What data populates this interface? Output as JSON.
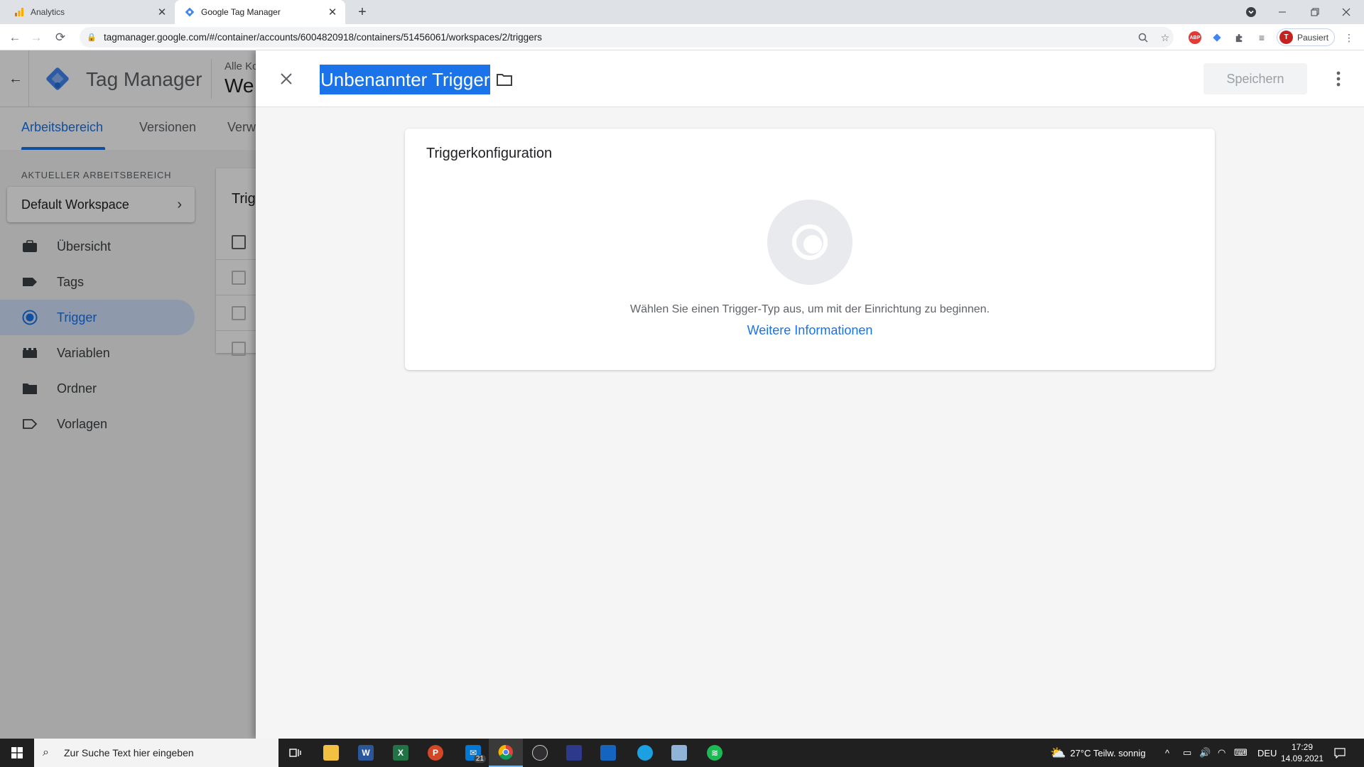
{
  "browser": {
    "tabs": [
      {
        "title": "Analytics",
        "icon": "analytics-icon",
        "active": false
      },
      {
        "title": "Google Tag Manager",
        "icon": "gtm-icon",
        "active": true
      }
    ],
    "url": "tagmanager.google.com/#/container/accounts/6004820918/containers/51456061/workspaces/2/triggers",
    "profile_initial": "T",
    "profile_status": "Pausiert"
  },
  "gtm": {
    "app_title": "Tag Manager",
    "breadcrumb": "Alle Ko",
    "container_name": "We",
    "tabs": [
      {
        "label": "Arbeitsbereich",
        "active": true
      },
      {
        "label": "Versionen",
        "active": false
      },
      {
        "label": "Verw",
        "active": false
      }
    ],
    "workspace_label": "AKTUELLER ARBEITSBEREICH",
    "workspace_name": "Default Workspace",
    "nav": [
      {
        "label": "Übersicht",
        "icon": "briefcase-icon",
        "active": false
      },
      {
        "label": "Tags",
        "icon": "tag-icon",
        "active": false
      },
      {
        "label": "Trigger",
        "icon": "trigger-icon",
        "active": true
      },
      {
        "label": "Variablen",
        "icon": "variables-icon",
        "active": false
      },
      {
        "label": "Ordner",
        "icon": "folder-icon",
        "active": false
      },
      {
        "label": "Vorlagen",
        "icon": "template-icon",
        "active": false
      }
    ],
    "list_title": "Trig"
  },
  "panel": {
    "trigger_name": "Unbenannter Trigger",
    "save_label": "Speichern",
    "config_title": "Triggerkonfiguration",
    "config_hint": "Wählen Sie einen Trigger-Typ aus, um mit der Einrichtung zu beginnen.",
    "config_link": "Weitere Informationen"
  },
  "taskbar": {
    "search_placeholder": "Zur Suche Text hier eingeben",
    "mail_badge": "21",
    "weather": "27°C  Teilw. sonnig",
    "language": "DEU",
    "time": "17:29",
    "date": "14.09.2021"
  },
  "colors": {
    "accent": "#1a73e8",
    "nav_active_bg": "#d2e3fc",
    "scrim": "rgba(0,0,0,0.32)"
  }
}
